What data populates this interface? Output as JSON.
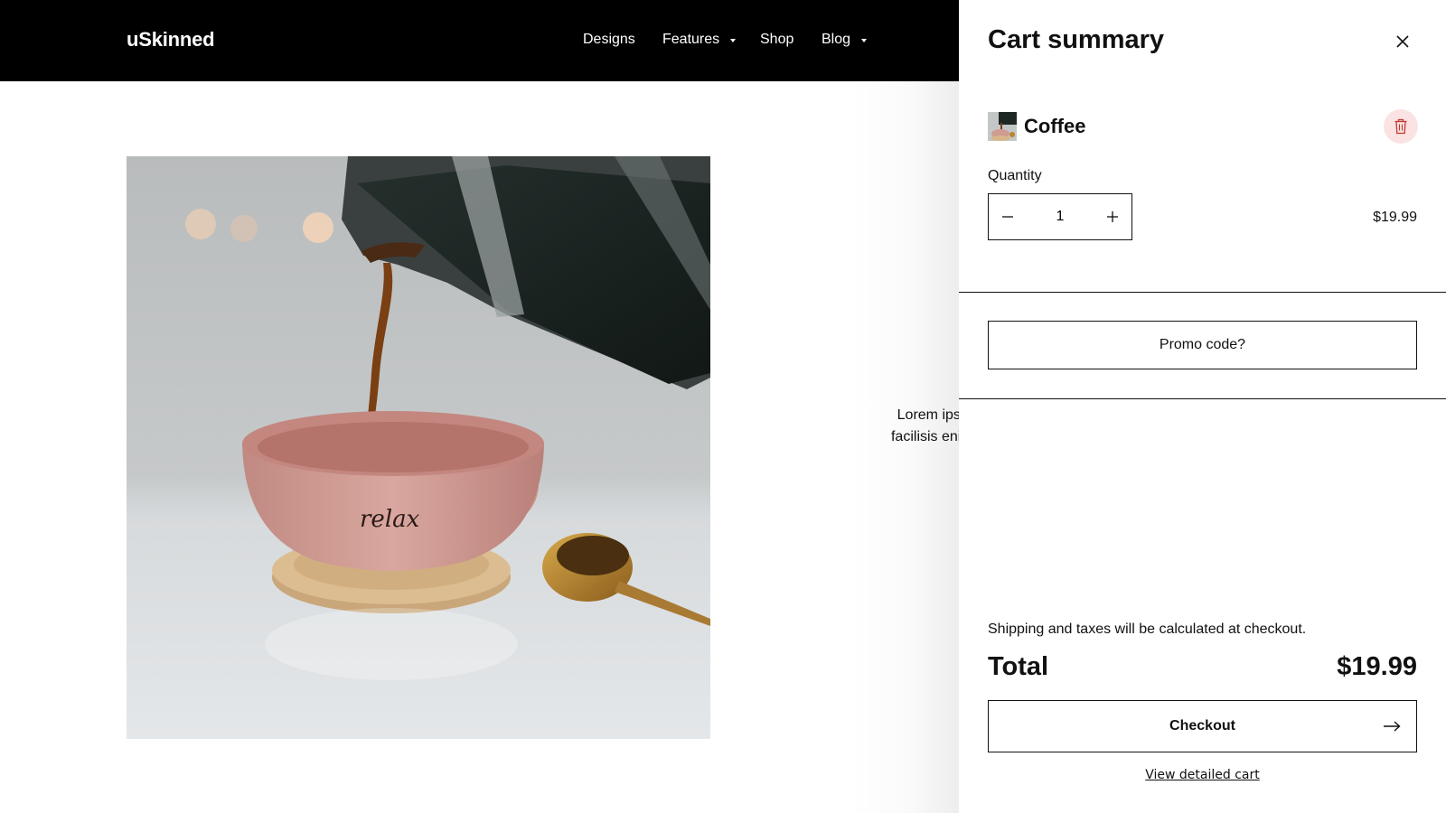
{
  "header": {
    "logo": "uSkinned",
    "nav": [
      {
        "label": "Designs",
        "has_dropdown": false
      },
      {
        "label": "Features",
        "has_dropdown": true
      },
      {
        "label": "Shop",
        "has_dropdown": false
      },
      {
        "label": "Blog",
        "has_dropdown": true
      }
    ]
  },
  "hero": {
    "image": "coffee-pouring-into-pink-cup-image",
    "cup_text": "relax"
  },
  "background_text": {
    "line1": "Lorem ipsum do",
    "line2": "facilisis enim molli"
  },
  "cart": {
    "title": "Cart summary",
    "close_icon": "close-icon",
    "item": {
      "name": "Coffee",
      "thumbnail": "coffee-thumbnail",
      "delete_icon": "trash-icon",
      "quantity_label": "Quantity",
      "quantity": "1",
      "price": "$19.99"
    },
    "promo_label": "Promo code?",
    "shipping_note": "Shipping and taxes will be calculated at checkout.",
    "total_label": "Total",
    "total_value": "$19.99",
    "checkout_label": "Checkout",
    "view_cart_label": "View detailed cart"
  },
  "colors": {
    "header_bg": "#000000",
    "delete_bg": "#fbe3e3",
    "delete_icon": "#c0392b",
    "text": "#111111"
  }
}
